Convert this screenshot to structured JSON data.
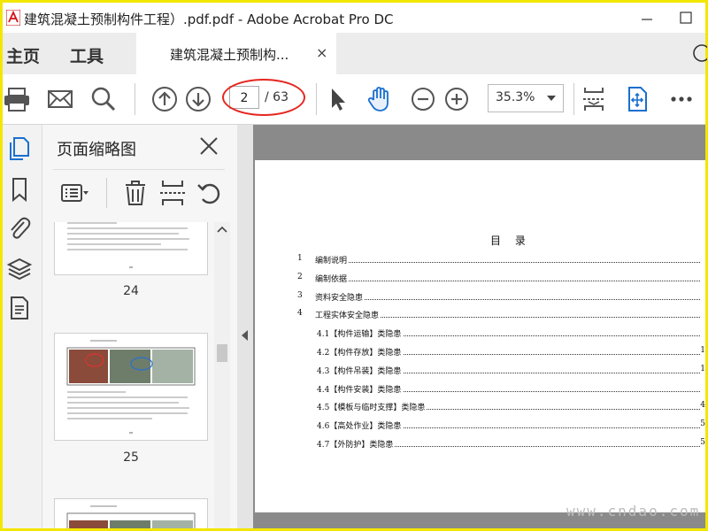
{
  "window": {
    "title": "建筑混凝土预制构件工程）.pdf.pdf - Adobe Acrobat Pro DC",
    "accent": "#f3e600"
  },
  "tabs": {
    "home": "主页",
    "tools": "工具",
    "document": "建筑混凝土预制构...",
    "close": "×"
  },
  "toolbar": {
    "current_page": "2",
    "total_pages": "/ 63",
    "zoom": "35.3%"
  },
  "thumbnails": {
    "title": "页面缩略图",
    "pages": [
      {
        "label": "24"
      },
      {
        "label": "25"
      }
    ],
    "scroll_position": 0.42
  },
  "document": {
    "toc_title": "目 录",
    "toc": [
      {
        "num": "1",
        "text": "编制说明",
        "indent": false,
        "page": ""
      },
      {
        "num": "2",
        "text": "编制依据",
        "indent": false,
        "page": ""
      },
      {
        "num": "3",
        "text": "资料安全隐患",
        "indent": false,
        "page": ""
      },
      {
        "num": "4",
        "text": "工程实体安全隐患",
        "indent": false,
        "page": ""
      },
      {
        "num": "",
        "text": "4.1【构件运输】类隐患",
        "indent": true,
        "page": ""
      },
      {
        "num": "",
        "text": "4.2【构件存放】类隐患",
        "indent": true,
        "page": "1"
      },
      {
        "num": "",
        "text": "4.3【构件吊装】类隐患",
        "indent": true,
        "page": "1"
      },
      {
        "num": "",
        "text": "4.4【构件安装】类隐患",
        "indent": true,
        "page": ""
      },
      {
        "num": "",
        "text": "4.5【模板与临时支撑】类隐患",
        "indent": true,
        "page": "4"
      },
      {
        "num": "",
        "text": "4.6【高处作业】类隐患",
        "indent": true,
        "page": "5"
      },
      {
        "num": "",
        "text": "4.7【外防护】类隐患",
        "indent": true,
        "page": "5"
      }
    ]
  },
  "watermark": "www.cndao.com"
}
